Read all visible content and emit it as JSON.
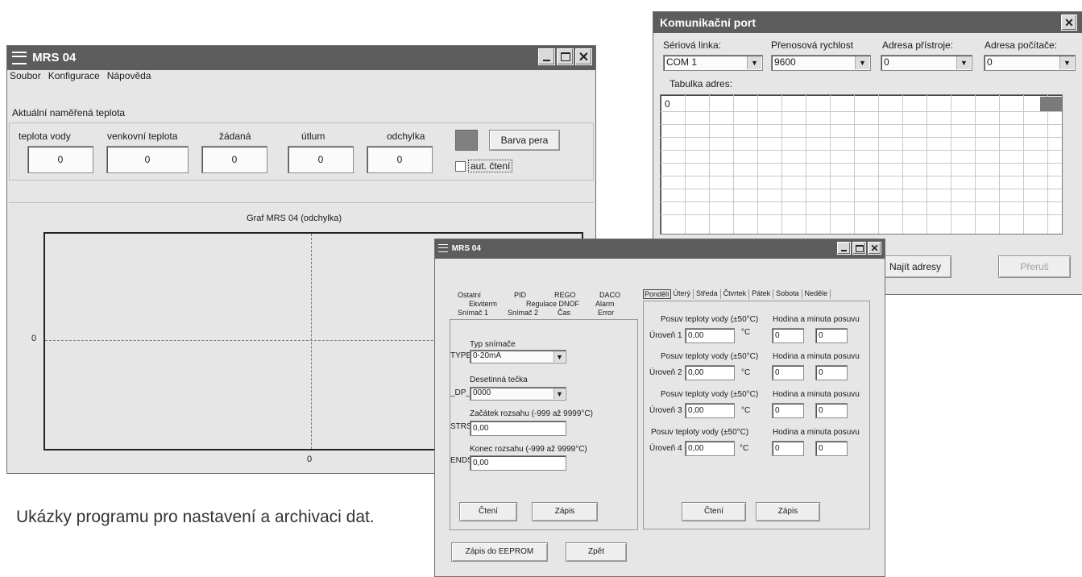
{
  "main_window": {
    "title": "MRS 04",
    "menu": [
      "Soubor",
      "Konfigurace",
      "Nápověda"
    ],
    "section_title": "Aktuální naměřená teplota",
    "fields": [
      {
        "label": "teplota vody",
        "value": "0"
      },
      {
        "label": "venkovní teplota",
        "value": "0"
      },
      {
        "label": "žádaná",
        "value": "0"
      },
      {
        "label": "útlum",
        "value": "0"
      },
      {
        "label": "odchylka",
        "value": "0"
      }
    ],
    "pen_button": "Barva pera",
    "auto_read_label": "aut. čtení",
    "auto_read_checked": false,
    "pen_color": "#808080",
    "graph": {
      "title": "Graf MRS 04 (odchylka)",
      "y_axis_label": "0",
      "x_axis_label": "0"
    }
  },
  "comm_window": {
    "title": "Komunikační port",
    "fields": [
      {
        "label": "Sériová linka:",
        "value": "COM 1"
      },
      {
        "label": "Přenosová rychlost",
        "value": "9600"
      },
      {
        "label": "Adresa přístroje:",
        "value": "0"
      },
      {
        "label": "Adresa počítače:",
        "value": "0"
      }
    ],
    "table_label": "Tabulka adres:",
    "table_first_cell": "0",
    "find_button": "Najít adresy",
    "stop_button": "Přeruš"
  },
  "settings_window": {
    "title": "MRS 04",
    "left_tabs_row1": [
      "Ostatní",
      "PID",
      "REGO",
      "DACO"
    ],
    "left_tabs_row2": [
      "Ekviterm",
      "Regulace DNOF",
      "Alarm"
    ],
    "left_tabs_row3": [
      "Snímač 1",
      "Snímač 2",
      "Čas",
      "Error"
    ],
    "sensor": {
      "type_caption": "Typ snímače",
      "type_tag": "TYPE",
      "type_value": "0-20mA",
      "dp_caption": "Desetinná tečka",
      "dp_tag": "_DP_",
      "dp_value": "0000",
      "strs_caption": "Začátek rozsahu (-999 až 9999°C)",
      "strs_tag": "STRS",
      "strs_value": "0,00",
      "ends_caption": "Konec rozsahu (-999 až 9999°C)",
      "ends_tag": "ENDS",
      "ends_value": "0,00"
    },
    "left_read_button": "Čtení",
    "left_write_button": "Zápis",
    "eeprom_button": "Zápis do EEPROM",
    "back_button": "Zpět",
    "day_tabs": [
      "Pondělí",
      "Úterý",
      "Středa",
      "Čtvrtek",
      "Pátek",
      "Sobota",
      "Neděle"
    ],
    "active_day": "Pondělí",
    "levels": [
      {
        "shift_caption": "Posuv teploty vody (±50°C)",
        "level_label": "Úroveň 1",
        "value": "0,00",
        "unit": "°C",
        "time_caption": "Hodina a minuta posuvu",
        "hour": "0",
        "minute": "0"
      },
      {
        "shift_caption": "Posuv teploty vody (±50°C)",
        "level_label": "Úroveň 2",
        "value": "0,00",
        "unit": "°C",
        "time_caption": "Hodina a minuta posuvu",
        "hour": "0",
        "minute": "0"
      },
      {
        "shift_caption": "Posuv teploty vody (±50°C)",
        "level_label": "Úroveň 3",
        "value": "0,00",
        "unit": "°C",
        "time_caption": "Hodina a minuta posuvu",
        "hour": "0",
        "minute": "0"
      },
      {
        "shift_caption": "Posuv teploty vody (±50°C)",
        "level_label": "Úroveň 4",
        "value": "0,00",
        "unit": "°C",
        "time_caption": "Hodina a minuta posuvu",
        "hour": "0",
        "minute": "0"
      }
    ],
    "right_read_button": "Čtení",
    "right_write_button": "Zápis"
  },
  "caption": "Ukázky programu pro nastavení a archivaci dat."
}
